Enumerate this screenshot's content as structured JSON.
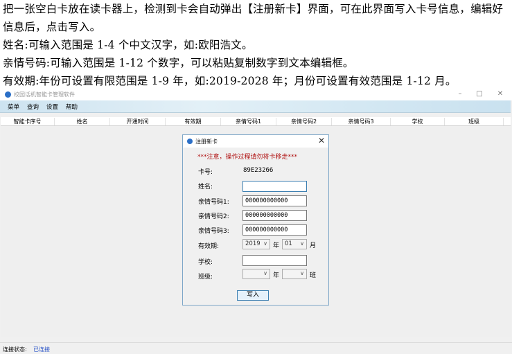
{
  "doc": {
    "lines": [
      "把一张空白卡放在读卡器上，检测到卡会自动弹出【注册新卡】界面，可在此界面写入卡号信息，编辑好信息后，点击写入。",
      "姓名:可输入范围是 1-4 个中文汉字，如:欧阳浩文。",
      "亲情号码:可输入范围是 1-12 个数字，可以粘贴复制数字到文本编辑框。",
      "有效期:年份可设置有限范围是 1-9 年，如:2019-2028 年；月份可设置有效范围是 1-12 月。"
    ]
  },
  "window": {
    "title": "校园话机智能卡管理软件",
    "buttons": {
      "minimize": "–",
      "maximize": "□",
      "close": "✕"
    }
  },
  "menu": [
    "菜单",
    "查询",
    "设置",
    "帮助"
  ],
  "table": {
    "columns": [
      "智能卡序号",
      "姓名",
      "开通时间",
      "有效期",
      "亲情号码1",
      "亲情号码2",
      "亲情号码3",
      "学校",
      "班级"
    ]
  },
  "status": {
    "label": "连接状态:",
    "value": "已连接"
  },
  "dialog": {
    "title": "注册新卡",
    "close": "✕",
    "notice": "***注意，操作过程请勿将卡移走***",
    "card_label": "卡号:",
    "card_value": "89E23266",
    "name_label": "姓名:",
    "name_value": "",
    "phone1_label": "亲情号码1:",
    "phone1_value": "000000000000",
    "phone2_label": "亲情号码2:",
    "phone2_value": "000000000000",
    "phone3_label": "亲情号码3:",
    "phone3_value": "000000000000",
    "validity_label": "有效期:",
    "year_value": "2019",
    "year_unit": "年",
    "month_value": "01",
    "month_unit": "月",
    "school_label": "学校:",
    "school_value": "",
    "class_label": "班级:",
    "class_year_value": "",
    "class_year_unit": "年",
    "class_value": "",
    "class_unit": "班",
    "write_button": "写入"
  },
  "colors": {
    "accent": "#2b6fc7",
    "notice": "#b01010",
    "menubar": "#d4e8f3"
  },
  "icons": {
    "app": "app-logo-icon",
    "dropdown": "chevron-down-icon"
  }
}
